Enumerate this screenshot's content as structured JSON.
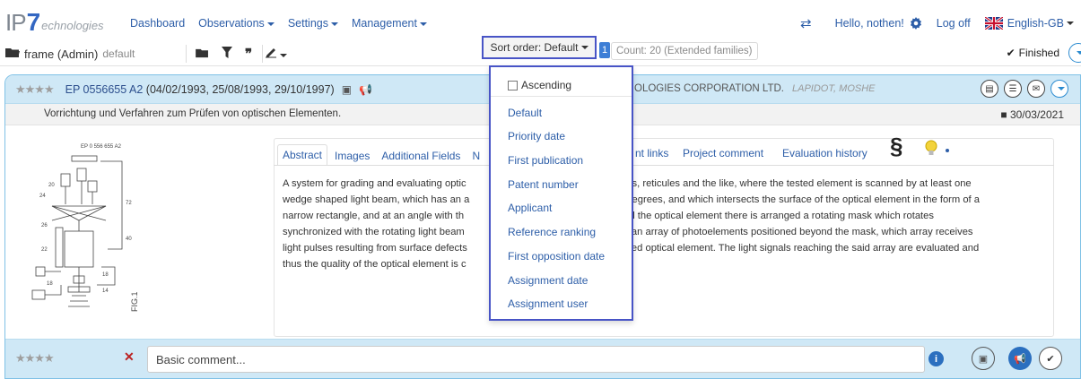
{
  "app": {
    "logo_ip": "IP",
    "logo_7": "7",
    "logo_tech": "echnologies"
  },
  "nav": {
    "dashboard": "Dashboard",
    "observations": "Observations",
    "settings": "Settings",
    "management": "Management",
    "greeting": "Hello, nothen!",
    "logoff": "Log off",
    "language": "English-GB"
  },
  "toolbar": {
    "frame": "frame (Admin)",
    "frame_default": "default",
    "sort_label": "Sort order: Default",
    "count_badge": "1",
    "count_text": "Count: 20 (Extended families)",
    "finished": "Finished"
  },
  "sort_menu": {
    "ascending": "Ascending",
    "options": [
      "Default",
      "Priority date",
      "First publication",
      "Patent number",
      "Applicant",
      "Reference ranking",
      "First opposition date",
      "Assignment date",
      "Assignment user"
    ]
  },
  "card": {
    "stars": "★★★★",
    "patent_number": "EP 0556655 A2",
    "dates": "(04/02/1993, 25/08/1993, 29/10/1997)",
    "company": "OLOGIES CORPORATION LTD.",
    "inventor": "LAPIDOT, MOSHE",
    "title": "Vorrichtung und Verfahren zum Prüfen von optischen Elementen.",
    "date": "30/03/2021",
    "figure_label": "FIG.1"
  },
  "tabs": {
    "abstract": "Abstract",
    "images": "Images",
    "additional_fields": "Additional Fields",
    "n_partial": "N",
    "links_partial": "nt links",
    "project_comment": "Project comment",
    "evaluation_history": "Evaluation history",
    "section_sign": "§"
  },
  "abstract_lines": [
    "A system for grading and evaluating optic",
    "wedge shaped light beam, which has an a",
    "narrow rectangle, and at an angle with th",
    "synchronized with the rotating light beam",
    "light pulses resulting from surface defects",
    "thus the quality of the optical element is c"
  ],
  "abstract_lines_right": [
    "lters, reticules and the like, where the tested element is scanned by at least one",
    "5 degrees, and which intersects the surface of the optical element in the form of a",
    "ond the optical element there is arranged a rotating mask which rotates",
    "es an array of photoelements positioned beyond the mask, which array receives",
    "ested optical element. The light signals reaching the said array are evaluated and",
    ""
  ],
  "footer": {
    "stars": "★★★★",
    "comment_placeholder": "Basic comment...",
    "info": "i"
  },
  "colors": {
    "accent": "#2d5ea8",
    "header_bg": "#cfe8f6",
    "highlight_border": "#4854c6"
  }
}
